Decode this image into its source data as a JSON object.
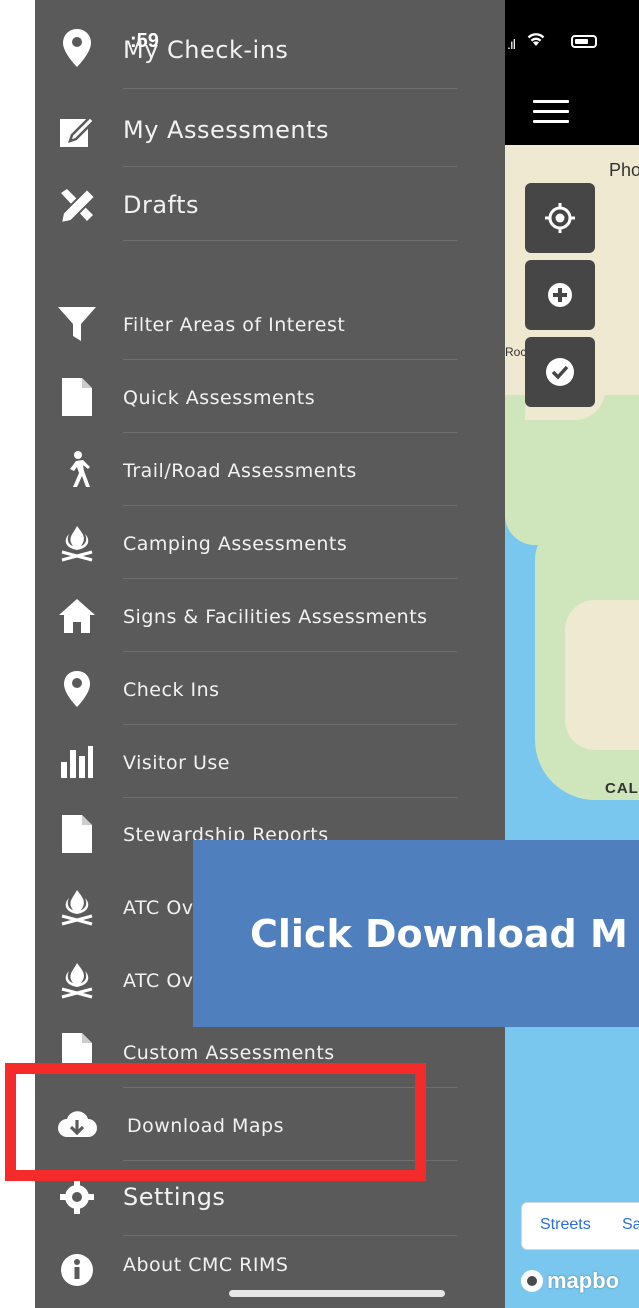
{
  "status_bar": {
    "time": ":59"
  },
  "drawer": {
    "items": [
      {
        "label": "My Check-ins",
        "icon": "location-pin-icon"
      },
      {
        "label": "My Assessments",
        "icon": "edit-icon"
      },
      {
        "label": "Drafts",
        "icon": "tools-icon"
      },
      {
        "label": "Filter Areas of Interest",
        "icon": "filter-icon"
      },
      {
        "label": "Quick Assessments",
        "icon": "document-icon"
      },
      {
        "label": "Trail/Road Assessments",
        "icon": "hiker-icon"
      },
      {
        "label": "Camping Assessments",
        "icon": "campfire-icon"
      },
      {
        "label": "Signs & Facilities Assessments",
        "icon": "home-icon"
      },
      {
        "label": "Check Ins",
        "icon": "location-pin-icon"
      },
      {
        "label": "Visitor Use",
        "icon": "bar-chart-icon"
      },
      {
        "label": "Stewardship Reports",
        "icon": "document-icon"
      },
      {
        "label": "ATC Ov",
        "icon": "campfire-icon"
      },
      {
        "label": "ATC Ov",
        "icon": "campfire-icon"
      },
      {
        "label": "Custom Assessments",
        "icon": "document-icon"
      },
      {
        "label": "Download Maps",
        "icon": "cloud-download-icon"
      },
      {
        "label": "Settings",
        "icon": "gear-icon"
      },
      {
        "label": "About CMC RIMS",
        "icon": "info-icon"
      }
    ]
  },
  "map": {
    "labels": {
      "pho": "Pho",
      "rocky_point": "Rocky Point",
      "cal": "CAL"
    },
    "style_switcher": {
      "streets": "Streets",
      "sa": "Sa"
    },
    "attribution": "mapbo"
  },
  "callout": {
    "text": "Click Download M"
  },
  "colors": {
    "drawer_bg": "#5a5a5a",
    "callout_bg": "#4f80bd",
    "highlight": "#f52b2b",
    "water": "#79c7ee"
  }
}
